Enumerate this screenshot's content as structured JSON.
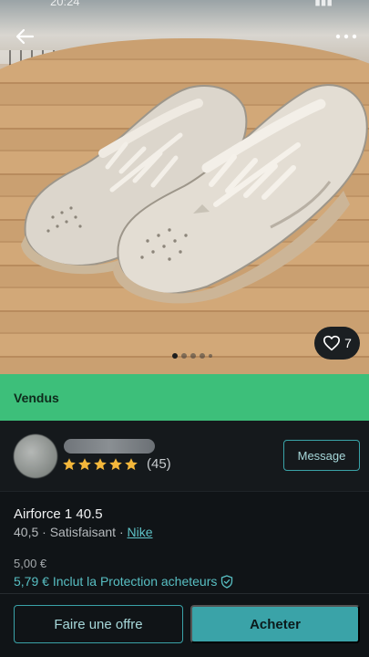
{
  "status_bar": {
    "time": "20:24",
    "indicators": "▮▮▮"
  },
  "toolbar": {
    "back_icon": "arrow-left-icon",
    "more_icon": "more-horizontal-icon"
  },
  "gallery": {
    "favorites_count": "7",
    "favorite_icon": "heart-outline-icon",
    "image_count": 5,
    "active_image": 1
  },
  "status_banner": {
    "label": "Vendus",
    "color": "#3dbf7a"
  },
  "seller": {
    "rating_stars": 5,
    "review_count": "(45)",
    "message_label": "Message"
  },
  "item": {
    "title": "Airforce 1 40.5",
    "size": "40,5",
    "separator": "·",
    "condition": "Satisfaisant",
    "brand": "Nike",
    "price": "5,00 €",
    "price_with_protection": "5,79 € Inclut la Protection acheteurs",
    "protection_icon": "shield-check-icon"
  },
  "actions": {
    "offer_label": "Faire une offre",
    "buy_label": "Acheter"
  },
  "colors": {
    "accent": "#3aa3a8",
    "sold": "#3dbf7a",
    "star": "#f4b73b",
    "background": "#101417"
  }
}
